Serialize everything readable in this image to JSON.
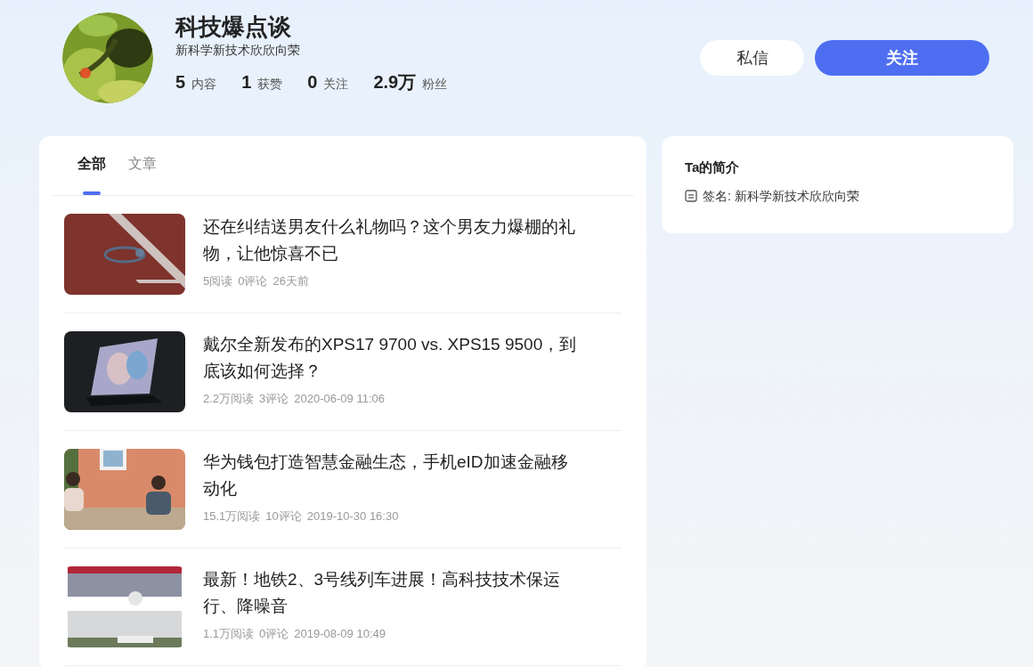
{
  "profile": {
    "name": "科技爆点谈",
    "bio": "新科学新技术欣欣向荣",
    "stats": [
      {
        "value": "5",
        "label": "内容"
      },
      {
        "value": "1",
        "label": "获赞"
      },
      {
        "value": "0",
        "label": "关注"
      },
      {
        "value": "2.9万",
        "label": "粉丝"
      }
    ],
    "buttons": [
      {
        "label": "私信",
        "kind": "secondary"
      },
      {
        "label": "关注",
        "kind": "primary"
      }
    ]
  },
  "tabs": [
    {
      "label": "全部",
      "selected": true
    },
    {
      "label": "文章",
      "selected": false
    }
  ],
  "articles": [
    {
      "title": "还在纠结送男友什么礼物吗？这个男友力爆棚的礼物，让他惊喜不已",
      "meta": [
        "5阅读",
        "0评论",
        "26天前"
      ]
    },
    {
      "title": "戴尔全新发布的XPS17 9700 vs. XPS15 9500，到底该如何选择？",
      "meta": [
        "2.2万阅读",
        "3评论",
        "2020-06-09 11:06"
      ]
    },
    {
      "title": "华为钱包打造智慧金融生态，手机eID加速金融移动化",
      "meta": [
        "15.1万阅读",
        "10评论",
        "2019-10-30 16:30"
      ]
    },
    {
      "title": "最新！地铁2、3号线列车进展！高科技技术保运行、降噪音",
      "meta": [
        "1.1万阅读",
        "0评论",
        "2019-08-09 10:49"
      ]
    }
  ],
  "intro": {
    "title": "Ta的简介",
    "signature": "签名: 新科学新技术欣欣向荣"
  }
}
